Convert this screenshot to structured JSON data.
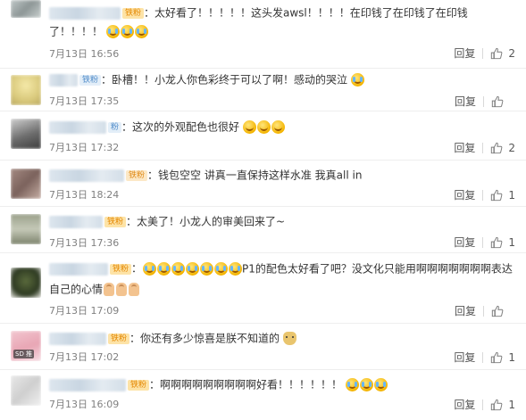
{
  "comments": [
    {
      "badge": "铁粉",
      "text": "：太好看了！！！！！这头发awsl！！！！在印钱了在印钱了在印钱了！！！！",
      "date": "7月13日 16:56",
      "reply": "回复",
      "likes": "2"
    },
    {
      "badge": "铁粉",
      "text": "：卧槽！！小龙人你色彩终于可以了啊！感动的哭泣",
      "date": "7月13日 17:35",
      "reply": "回复",
      "likes": ""
    },
    {
      "badge": "粉",
      "text": "：这次的外观配色也很好",
      "date": "7月13日 17:32",
      "reply": "回复",
      "likes": "2"
    },
    {
      "badge": "铁粉",
      "text": "：钱包空空  讲真一直保持这样水准  我真all in",
      "date": "7月13日 18:24",
      "reply": "回复",
      "likes": "1"
    },
    {
      "badge": "铁粉",
      "text": "：太美了！小龙人的审美回来了~",
      "date": "7月13日 17:36",
      "reply": "回复",
      "likes": "1"
    },
    {
      "badge": "铁粉",
      "text": "P1的配色太好看了吧？没文化只能用啊啊啊啊啊啊啊表达自己的心情",
      "date": "7月13日 17:09",
      "reply": "回复",
      "likes": ""
    },
    {
      "badge": "铁粉",
      "text": "：你还有多少惊喜是朕不知道的",
      "date": "7月13日 17:02",
      "reply": "回复",
      "likes": "1",
      "avatar_tag": "SD 推"
    },
    {
      "badge": "铁粉",
      "text": "：啊啊啊啊啊啊啊啊啊好看！！！！！！",
      "date": "7月13日 16:09",
      "reply": "回复",
      "likes": "1"
    }
  ],
  "colors": {
    "fan_badge_bg": "#fde3a7",
    "fan_badge_text": "#e48700",
    "meta_text": "#808080",
    "divider": "#eeeeee"
  },
  "icons": {
    "like": "thumbs-up-icon",
    "emoji": "emoji-icon"
  }
}
